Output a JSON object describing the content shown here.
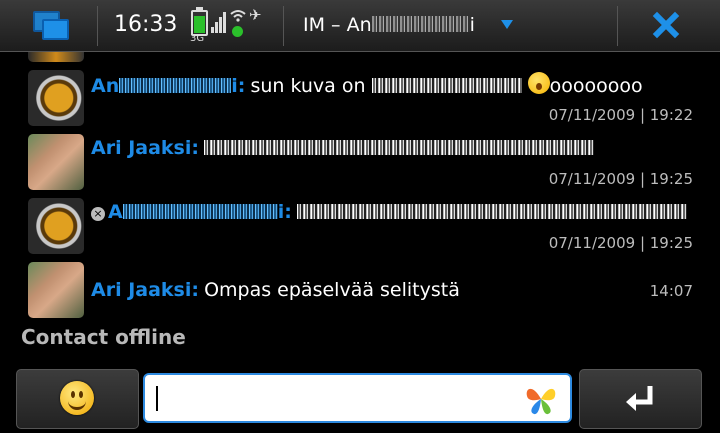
{
  "statusbar": {
    "time": "16:33",
    "network": "3G",
    "title_prefix": "IM – An",
    "title_suffix": "i",
    "colors": {
      "accent": "#1e90e8",
      "battery": "#2bc02b"
    },
    "icons": [
      "task-switcher-icon",
      "battery-icon",
      "signal-icon",
      "wifi-icon",
      "presence-icon",
      "dropdown-arrow-icon",
      "close-icon"
    ]
  },
  "messages": [
    {
      "sender_prefix": "An",
      "sender_suffix": "i:",
      "text_prefix": "sun kuva on",
      "text_suffix": "oooooooo",
      "timestamp": "07/11/2009 | 19:22"
    },
    {
      "sender": "Ari Jaaksi:",
      "timestamp": "07/11/2009 | 19:25"
    },
    {
      "sender_prefix": "A",
      "sender_suffix": "i:",
      "timestamp": "07/11/2009 | 19:25"
    },
    {
      "sender": "Ari Jaaksi:",
      "text": "Ompas epäselvää selitystä",
      "timestamp": "14:07"
    }
  ],
  "contact_status": "Contact offline",
  "input": {
    "value": "",
    "icons": [
      "smiley-icon",
      "butterfly-icon",
      "enter-icon"
    ]
  }
}
